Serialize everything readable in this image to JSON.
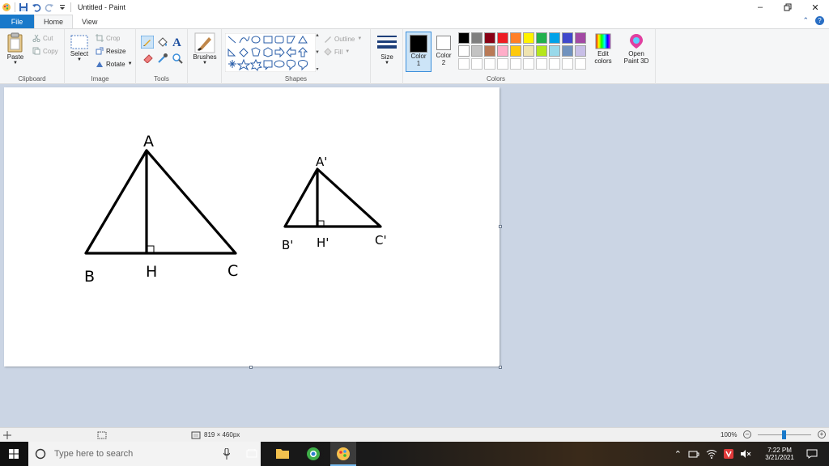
{
  "window": {
    "title": "Untitled - Paint",
    "controls": [
      "minimize",
      "restore",
      "close"
    ]
  },
  "ribbon": {
    "tabs": [
      {
        "label": "File"
      },
      {
        "label": "Home"
      },
      {
        "label": "View"
      }
    ],
    "groups": {
      "clipboard": {
        "label": "Clipboard",
        "paste": "Paste",
        "cut": "Cut",
        "copy": "Copy"
      },
      "image": {
        "label": "Image",
        "select": "Select",
        "crop": "Crop",
        "resize": "Resize",
        "rotate": "Rotate"
      },
      "tools": {
        "label": "Tools"
      },
      "brushes": {
        "label": "Brushes"
      },
      "shapes": {
        "label": "Shapes",
        "outline": "Outline",
        "fill": "Fill"
      },
      "size": {
        "label": "Size"
      },
      "colors": {
        "label": "Colors",
        "color1": "Color 1",
        "color1_line1": "Color",
        "color1_line2": "1",
        "color2_line1": "Color",
        "color2_line2": "2",
        "edit_line1": "Edit",
        "edit_line2": "colors",
        "paint3d_line1": "Open",
        "paint3d_line2": "Paint 3D",
        "palette_row1": [
          "#000000",
          "#7f7f7f",
          "#880015",
          "#ed1c24",
          "#ff7f27",
          "#fff200",
          "#22b14c",
          "#00a2e8",
          "#3f48cc",
          "#a349a4"
        ],
        "palette_row2": [
          "#ffffff",
          "#c3c3c3",
          "#b97a57",
          "#ffaec9",
          "#ffc90e",
          "#efe4b0",
          "#b5e61d",
          "#99d9ea",
          "#7092be",
          "#c8bfe7"
        ],
        "color1_value": "#000000",
        "color2_value": "#ffffff"
      }
    }
  },
  "drawing": {
    "big_triangle": {
      "A": "A",
      "B": "B",
      "C": "C",
      "H": "H"
    },
    "small_triangle": {
      "A": "A'",
      "B": "B'",
      "C": "C'",
      "H": "H'"
    }
  },
  "statusbar": {
    "canvas_size": "819 × 460px",
    "zoom": "100%"
  },
  "taskbar": {
    "search_placeholder": "Type here to search",
    "time": "7:22 PM",
    "date": "3/21/2021"
  }
}
